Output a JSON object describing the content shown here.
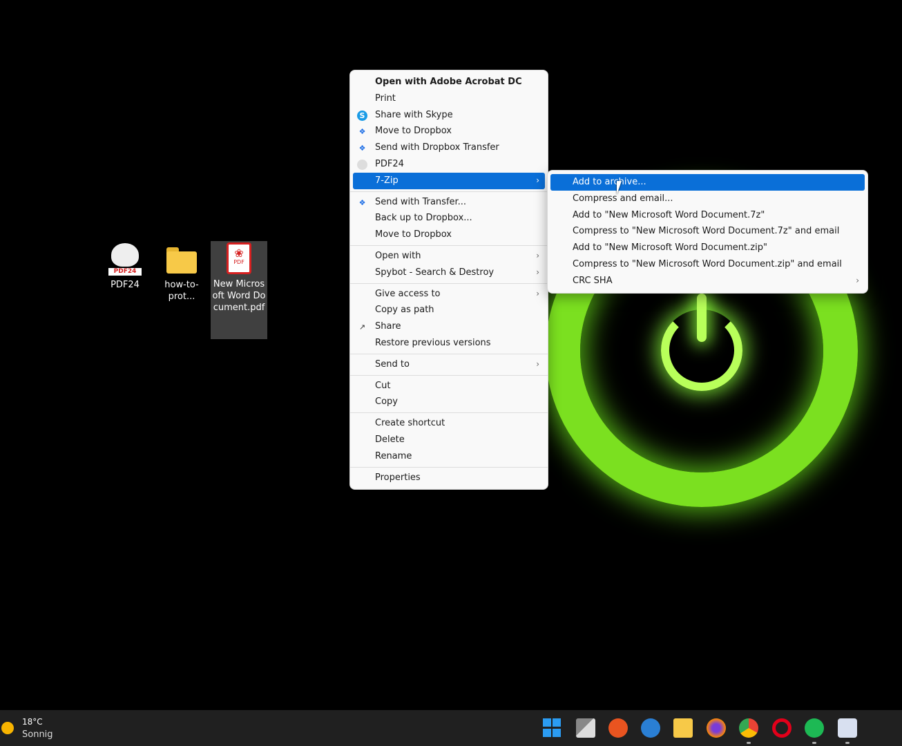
{
  "desktop": {
    "icons": [
      {
        "label": "PDF24",
        "badge": "PDF24"
      },
      {
        "label": "how-to-prot..."
      },
      {
        "label": "New Microsoft Word Document.pdf",
        "badge": "PDF"
      }
    ]
  },
  "context_menu": {
    "items": [
      {
        "label": "Open with Adobe Acrobat DC"
      },
      {
        "label": "Print"
      },
      {
        "label": "Share with Skype",
        "icon": "skype-icon"
      },
      {
        "label": "Move to Dropbox",
        "icon": "dropbox-icon"
      },
      {
        "label": "Send with Dropbox Transfer",
        "icon": "dropbox-icon"
      },
      {
        "label": "PDF24",
        "icon": "pdf24-icon"
      },
      {
        "label": "7-Zip",
        "submenu": true
      },
      {
        "label": "Send with Transfer...",
        "icon": "dropbox-icon"
      },
      {
        "label": "Back up to Dropbox..."
      },
      {
        "label": "Move to Dropbox"
      },
      {
        "label": "Open with",
        "submenu": true
      },
      {
        "label": "Spybot - Search & Destroy",
        "submenu": true
      },
      {
        "label": "Give access to",
        "submenu": true
      },
      {
        "label": "Copy as path"
      },
      {
        "label": "Share",
        "icon": "share-icon"
      },
      {
        "label": "Restore previous versions"
      },
      {
        "label": "Send to",
        "submenu": true
      },
      {
        "label": "Cut"
      },
      {
        "label": "Copy"
      },
      {
        "label": "Create shortcut"
      },
      {
        "label": "Delete"
      },
      {
        "label": "Rename"
      },
      {
        "label": "Properties"
      }
    ]
  },
  "submenu_7zip": {
    "items": [
      {
        "label": "Add to archive..."
      },
      {
        "label": "Compress and email..."
      },
      {
        "label": "Add to \"New Microsoft Word Document.7z\""
      },
      {
        "label": "Compress to \"New Microsoft Word Document.7z\" and email"
      },
      {
        "label": "Add to \"New Microsoft Word Document.zip\""
      },
      {
        "label": "Compress to \"New Microsoft Word Document.zip\" and email"
      },
      {
        "label": "CRC SHA",
        "submenu": true
      }
    ]
  },
  "taskbar": {
    "weather_temp": "18°C",
    "weather_condition": "Sonnig",
    "apps": [
      "start-icon",
      "task-view-icon",
      "ubuntu-icon",
      "thunderbird-icon",
      "file-explorer-icon",
      "firefox-icon",
      "chrome-icon",
      "opera-icon",
      "spotify-icon",
      "app-icon"
    ]
  },
  "colors": {
    "accent": "#0a6fd8",
    "wallpaper_glow": "#7be020",
    "taskbar": "#202020"
  }
}
